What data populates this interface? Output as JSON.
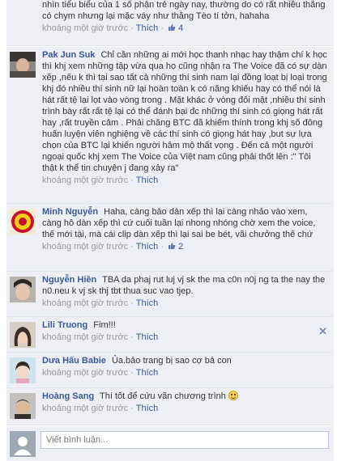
{
  "comments": [
    {
      "author": "",
      "text": "nhìn tiểu biểu của 1 số phận trẻ ngày nay, thường do có rất nhiều thằng có chym nhưng lại mặc váy như thằng Tèo tí tởn, hahaha",
      "time": "khoảng một giờ trước",
      "like": "Thích",
      "likes": "4"
    },
    {
      "author": "Pak Jun Suk",
      "text": "Chỉ cần những ai mới học thanh nhạc hay thậm chí k học thì khj xem những tập vừa qua họ cũng nhận ra The Voice đã có sự dàn xếp ,nếu k thì tại sao tất cả những thí sinh nam lại đồng loạt bị loại trong khj đó nhiều thí sinh nữ lại hoàn toàn k có năng khiếu hay có thể nói là hát rất tệ lại lọt vào vòng trong . Mặt khác ở vòng đối mặt ,nhiều thí sinh trình bày rất rất tệ lại có thể đánh bại đc những thí sinh có giọng hát rất hay ,rất truyền cảm . Phải chăng BTC đã khiếm thính trong khj số đông huấn luyện viên nghiệng về các thí sinh có giọng hát hay ,but sự lựa chọn của BTC lại khiến người hâm mộ thất vọng . Đến cả một người ngoại quốc khj xem The Voice của Việt nam cũng phải thốt lên :\" Tôi thật k thể tin chuyện j đang xảy ra\"",
      "time": "khoảng một giờ trước",
      "like": "Thích",
      "likes": ""
    },
    {
      "author": "Minh Nguyễn",
      "text": "Haha, càng bảo dàn xếp thì lại càng nhảo vào xem, càng hô dàn xếp thì cứ cuối tuần lại nhong nhóng chờ xem the voice, thế mới tài, mà cái clip dàn xếp thì lại sai be bét, vãi chưởng thế chứ",
      "time": "khoảng một giờ trước",
      "like": "Thích",
      "likes": "2"
    },
    {
      "author": "Nguyễn Hiền",
      "text": "TBA da phaj rut luj vj sk the ma c0n n0j ng ta the nay the n0.neu k vj sk thj tbt thua suc vao tjep.",
      "time": "khoảng một giờ trước",
      "like": "Thích",
      "likes": ""
    },
    {
      "author": "Lili Truong",
      "text": "Fim!!!",
      "time": "khoảng một giờ trước",
      "like": "Thích",
      "likes": ""
    },
    {
      "author": "Dưa Hấu Babie",
      "text": "Ủa.bảo trang bị sao cợ bả con",
      "time": "khoảng một giờ trước",
      "like": "Thích",
      "likes": ""
    },
    {
      "author": "Hoàng Sang",
      "text": "Thí tốt để cứu vãn chương trình",
      "time": "khoảng một giờ trước",
      "like": "Thích",
      "likes": ""
    }
  ],
  "separator": "·",
  "close_glyph": "✕",
  "write_comment": {
    "placeholder": "Viết bình luận..."
  },
  "colors": {
    "link": "#3b5998",
    "row_bg": "#edeff4",
    "meta": "#999999"
  },
  "icons": {
    "like": "thumbs-up-icon",
    "close": "close-icon",
    "smiley": "smiley-emoticon"
  }
}
